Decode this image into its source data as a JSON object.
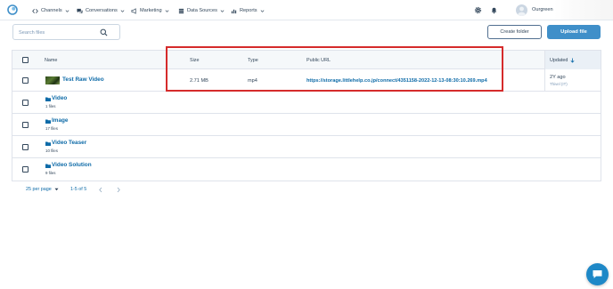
{
  "nav": {
    "items": [
      {
        "label": "Channels",
        "icon": "code-brackets-icon"
      },
      {
        "label": "Conversations",
        "icon": "chat-bubbles-icon"
      },
      {
        "label": "Marketing",
        "icon": "megaphone-icon"
      },
      {
        "label": "Data Sources",
        "icon": "database-icon"
      },
      {
        "label": "Reports",
        "icon": "bar-chart-icon"
      }
    ],
    "account_name": "Ourgreen"
  },
  "toolbar": {
    "search_placeholder": "Search files",
    "create_folder_label": "Create folder",
    "upload_file_label": "Upload file"
  },
  "table": {
    "columns": {
      "name": "Name",
      "size": "Size",
      "type": "Type",
      "public_url": "Public URL",
      "updated": "Updated"
    },
    "file_row": {
      "name": "Test Raw Video",
      "size": "2.71 MB",
      "type": "mp4",
      "public_url": "https://storage.littlehelp.co.jp/connect/4351158-2022-12-13-08:30:10.269.mp4",
      "updated": "2Y ago",
      "updated_by": "Thivel (IT)"
    },
    "folders": [
      {
        "name": "Video",
        "count": "1 files"
      },
      {
        "name": "Image",
        "count": "17 files"
      },
      {
        "name": "Video Teaser",
        "count": "10 files"
      },
      {
        "name": "Video Solution",
        "count": "9 files"
      }
    ]
  },
  "pagination": {
    "per_page": "25 per page",
    "range": "1-5 of 5"
  },
  "colors": {
    "accent": "#3f8fc9",
    "link": "#0e6ba8",
    "highlight": "#d52b2b",
    "chat": "#1e88c7"
  }
}
